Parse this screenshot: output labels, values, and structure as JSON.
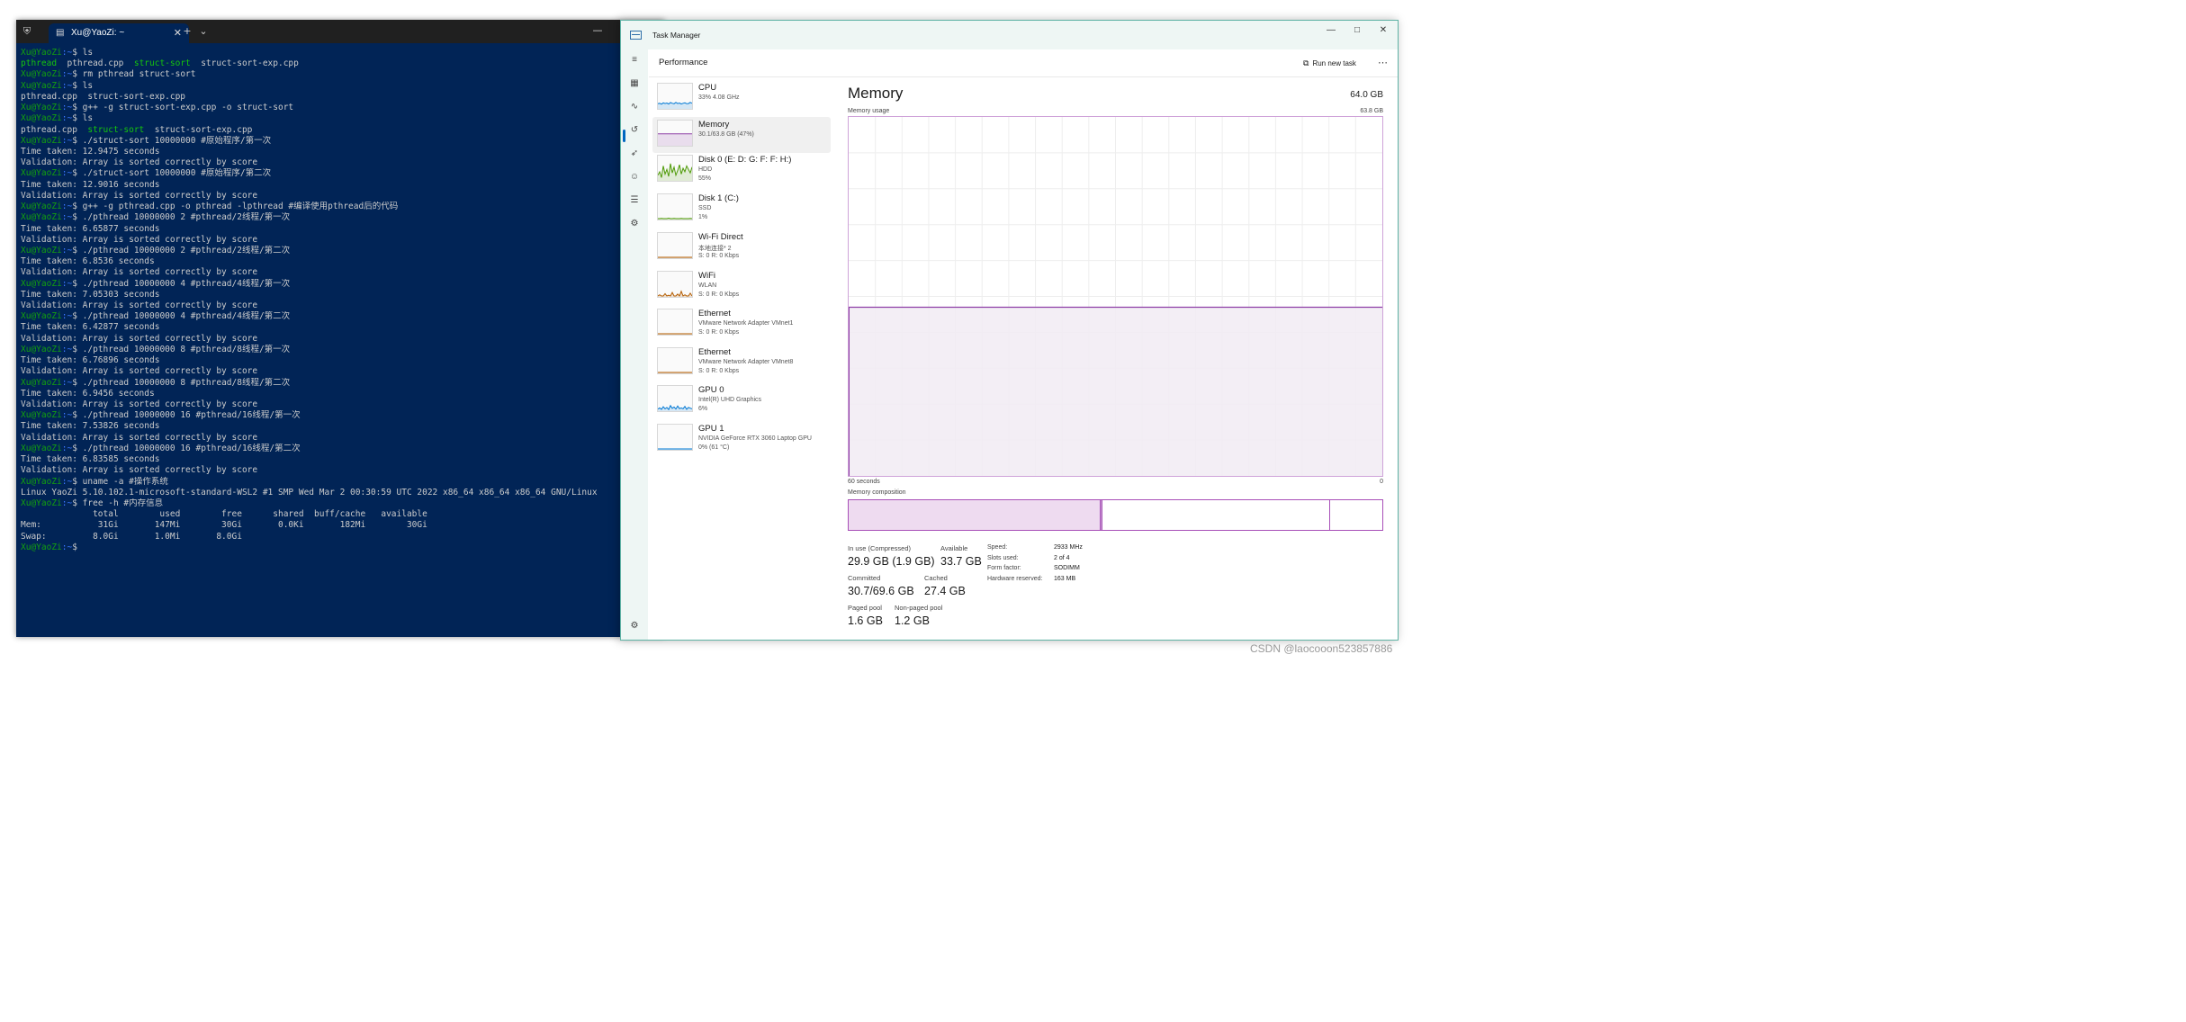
{
  "terminal": {
    "tab_title": "Xu@YaoZi: ~",
    "lines": [
      {
        "kind": "prompt",
        "user": "Xu@YaoZi",
        "path": ":~",
        "cmd": "$ ls"
      },
      {
        "kind": "files",
        "green": "pthread",
        "plain1": "  pthread.cpp  ",
        "green2": "struct-sort",
        "plain2": "  struct-sort-exp.cpp"
      },
      {
        "kind": "prompt",
        "user": "Xu@YaoZi",
        "path": ":~",
        "cmd": "$ rm pthread struct-sort"
      },
      {
        "kind": "prompt",
        "user": "Xu@YaoZi",
        "path": ":~",
        "cmd": "$ ls"
      },
      {
        "kind": "text",
        "text": "pthread.cpp  struct-sort-exp.cpp"
      },
      {
        "kind": "prompt",
        "user": "Xu@YaoZi",
        "path": ":~",
        "cmd": "$ g++ -g struct-sort-exp.cpp -o struct-sort"
      },
      {
        "kind": "prompt",
        "user": "Xu@YaoZi",
        "path": ":~",
        "cmd": "$ ls"
      },
      {
        "kind": "files",
        "green": "",
        "plain1": "pthread.cpp  ",
        "green2": "struct-sort",
        "plain2": "  struct-sort-exp.cpp"
      },
      {
        "kind": "prompt",
        "user": "Xu@YaoZi",
        "path": ":~",
        "cmd": "$ ./struct-sort 10000000 #原始程序/第一次"
      },
      {
        "kind": "text",
        "text": "Time taken: 12.9475 seconds"
      },
      {
        "kind": "text",
        "text": "Validation: Array is sorted correctly by score"
      },
      {
        "kind": "prompt",
        "user": "Xu@YaoZi",
        "path": ":~",
        "cmd": "$ ./struct-sort 10000000 #原始程序/第二次"
      },
      {
        "kind": "text",
        "text": "Time taken: 12.9016 seconds"
      },
      {
        "kind": "text",
        "text": "Validation: Array is sorted correctly by score"
      },
      {
        "kind": "prompt",
        "user": "Xu@YaoZi",
        "path": ":~",
        "cmd": "$ g++ -g pthread.cpp -o pthread -lpthread #编译使用pthread后的代码"
      },
      {
        "kind": "prompt",
        "user": "Xu@YaoZi",
        "path": ":~",
        "cmd": "$ ./pthread 10000000 2 #pthread/2线程/第一次"
      },
      {
        "kind": "text",
        "text": "Time taken: 6.65877 seconds"
      },
      {
        "kind": "text",
        "text": "Validation: Array is sorted correctly by score"
      },
      {
        "kind": "prompt",
        "user": "Xu@YaoZi",
        "path": ":~",
        "cmd": "$ ./pthread 10000000 2 #pthread/2线程/第二次"
      },
      {
        "kind": "text",
        "text": "Time taken: 6.8536 seconds"
      },
      {
        "kind": "text",
        "text": "Validation: Array is sorted correctly by score"
      },
      {
        "kind": "prompt",
        "user": "Xu@YaoZi",
        "path": ":~",
        "cmd": "$ ./pthread 10000000 4 #pthread/4线程/第一次"
      },
      {
        "kind": "text",
        "text": "Time taken: 7.05303 seconds"
      },
      {
        "kind": "text",
        "text": "Validation: Array is sorted correctly by score"
      },
      {
        "kind": "prompt",
        "user": "Xu@YaoZi",
        "path": ":~",
        "cmd": "$ ./pthread 10000000 4 #pthread/4线程/第二次"
      },
      {
        "kind": "text",
        "text": "Time taken: 6.42877 seconds"
      },
      {
        "kind": "text",
        "text": "Validation: Array is sorted correctly by score"
      },
      {
        "kind": "prompt",
        "user": "Xu@YaoZi",
        "path": ":~",
        "cmd": "$ ./pthread 10000000 8 #pthread/8线程/第一次"
      },
      {
        "kind": "text",
        "text": "Time taken: 6.76896 seconds"
      },
      {
        "kind": "text",
        "text": "Validation: Array is sorted correctly by score"
      },
      {
        "kind": "prompt",
        "user": "Xu@YaoZi",
        "path": ":~",
        "cmd": "$ ./pthread 10000000 8 #pthread/8线程/第二次"
      },
      {
        "kind": "text",
        "text": "Time taken: 6.9456 seconds"
      },
      {
        "kind": "text",
        "text": "Validation: Array is sorted correctly by score"
      },
      {
        "kind": "prompt",
        "user": "Xu@YaoZi",
        "path": ":~",
        "cmd": "$ ./pthread 10000000 16 #pthread/16线程/第一次"
      },
      {
        "kind": "text",
        "text": "Time taken: 7.53826 seconds"
      },
      {
        "kind": "text",
        "text": "Validation: Array is sorted correctly by score"
      },
      {
        "kind": "prompt",
        "user": "Xu@YaoZi",
        "path": ":~",
        "cmd": "$ ./pthread 10000000 16 #pthread/16线程/第二次"
      },
      {
        "kind": "text",
        "text": "Time taken: 6.83585 seconds"
      },
      {
        "kind": "text",
        "text": "Validation: Array is sorted correctly by score"
      },
      {
        "kind": "prompt",
        "user": "Xu@YaoZi",
        "path": ":~",
        "cmd": "$ uname -a #操作系统"
      },
      {
        "kind": "text",
        "text": "Linux YaoZi 5.10.102.1-microsoft-standard-WSL2 #1 SMP Wed Mar 2 00:30:59 UTC 2022 x86_64 x86_64 x86_64 GNU/Linux"
      },
      {
        "kind": "prompt",
        "user": "Xu@YaoZi",
        "path": ":~",
        "cmd": "$ free -h #内存信息"
      },
      {
        "kind": "text",
        "text": "              total        used        free      shared  buff/cache   available"
      },
      {
        "kind": "text",
        "text": "Mem:           31Gi       147Mi        30Gi       0.0Ki       182Mi        30Gi"
      },
      {
        "kind": "text",
        "text": "Swap:         8.0Gi       1.0Mi       8.0Gi"
      },
      {
        "kind": "prompt",
        "user": "Xu@YaoZi",
        "path": ":~",
        "cmd": "$"
      }
    ],
    "colors": {
      "background": "#012456",
      "prompt_user": "#13a10e",
      "prompt_path": "#3b78ff",
      "exec_file": "#16c60c"
    }
  },
  "task_manager": {
    "title": "Task Manager",
    "section": "Performance",
    "run_new_task": "Run new task",
    "resources": [
      {
        "name": "CPU",
        "lines": [
          "33%  4.08 GHz"
        ],
        "color": "#0078d4",
        "spark": [
          18,
          20,
          16,
          22,
          19,
          21,
          17,
          23,
          20,
          18,
          24,
          19,
          21,
          17,
          20,
          22,
          18,
          19,
          24,
          20
        ]
      },
      {
        "name": "Memory",
        "lines": [
          "30.1/63.8 GB (47%)"
        ],
        "color": "#8e3fa6",
        "spark": [
          47,
          47,
          47,
          47,
          47,
          47,
          47,
          47,
          47,
          47,
          47,
          47,
          47,
          47,
          47,
          47,
          47,
          47,
          47,
          47
        ],
        "selected": true
      },
      {
        "name": "Disk 0 (E: D: G: F: F: H:)",
        "lines": [
          "HDD",
          "55%"
        ],
        "color": "#4e9a06",
        "spark": [
          20,
          35,
          10,
          60,
          25,
          45,
          15,
          70,
          30,
          55,
          20,
          40,
          65,
          25,
          50,
          35,
          60,
          45,
          30,
          55
        ]
      },
      {
        "name": "Disk 1 (C:)",
        "lines": [
          "SSD",
          "1%"
        ],
        "color": "#4e9a06",
        "spark": [
          0,
          0,
          1,
          0,
          0,
          0,
          2,
          0,
          0,
          1,
          0,
          0,
          0,
          1,
          0,
          0,
          0,
          0,
          1,
          0
        ]
      },
      {
        "name": "Wi-Fi Direct",
        "lines": [
          "本地连接* 2",
          "S: 0 R: 0 Kbps"
        ],
        "color": "#b35c00",
        "spark": [
          0,
          0,
          0,
          0,
          0,
          0,
          0,
          0,
          0,
          0,
          0,
          0,
          0,
          0,
          0,
          0,
          0,
          0,
          0,
          0
        ]
      },
      {
        "name": "WiFi",
        "lines": [
          "WLAN",
          "S: 0 R: 0 Kbps"
        ],
        "color": "#b35c00",
        "spark": [
          0,
          5,
          0,
          0,
          10,
          0,
          3,
          0,
          15,
          0,
          0,
          8,
          0,
          20,
          0,
          5,
          0,
          0,
          12,
          0
        ]
      },
      {
        "name": "Ethernet",
        "lines": [
          "VMware Network Adapter VMnet1",
          "S: 0 R: 0 Kbps"
        ],
        "color": "#b35c00",
        "spark": [
          0,
          0,
          0,
          0,
          0,
          0,
          0,
          0,
          0,
          0,
          0,
          0,
          0,
          0,
          0,
          0,
          0,
          0,
          0,
          0
        ]
      },
      {
        "name": "Ethernet",
        "lines": [
          "VMware Network Adapter VMnet8",
          "S: 0 R: 0 Kbps"
        ],
        "color": "#b35c00",
        "spark": [
          0,
          0,
          0,
          0,
          0,
          0,
          0,
          0,
          0,
          0,
          0,
          0,
          0,
          0,
          0,
          0,
          0,
          0,
          0,
          0
        ]
      },
      {
        "name": "GPU 0",
        "lines": [
          "Intel(R) UHD Graphics",
          "6%"
        ],
        "color": "#0078d4",
        "spark": [
          5,
          10,
          4,
          15,
          6,
          12,
          3,
          20,
          8,
          14,
          5,
          18,
          7,
          10,
          6,
          16,
          4,
          12,
          9,
          6
        ]
      },
      {
        "name": "GPU 1",
        "lines": [
          "NVIDIA GeForce RTX 3060 Laptop GPU",
          "0% (61 °C)"
        ],
        "color": "#0078d4",
        "spark": [
          0,
          0,
          0,
          0,
          0,
          0,
          0,
          0,
          0,
          0,
          0,
          0,
          0,
          0,
          0,
          0,
          0,
          0,
          0,
          0
        ]
      }
    ],
    "memory": {
      "title": "Memory",
      "total": "64.0 GB",
      "usage_label": "Memory usage",
      "max_label": "63.8 GB",
      "time_label": "60 seconds",
      "zero_label": "0",
      "composition_label": "Memory composition",
      "usage_fraction": 0.47,
      "composition": {
        "in_use": 0.47,
        "modified": 0.004,
        "standby": 0.426,
        "free": 0.1
      },
      "stats": {
        "in_use_label": "In use (Compressed)",
        "in_use_value": "29.9 GB (1.9 GB)",
        "available_label": "Available",
        "available_value": "33.7 GB",
        "committed_label": "Committed",
        "committed_value": "30.7/69.6 GB",
        "cached_label": "Cached",
        "cached_value": "27.4 GB",
        "paged_label": "Paged pool",
        "paged_value": "1.6 GB",
        "nonpaged_label": "Non-paged pool",
        "nonpaged_value": "1.2 GB"
      },
      "details": [
        {
          "key": "Speed:",
          "value": "2933 MHz"
        },
        {
          "key": "Slots used:",
          "value": "2 of 4"
        },
        {
          "key": "Form factor:",
          "value": "SODIMM"
        },
        {
          "key": "Hardware reserved:",
          "value": "163 MB"
        }
      ],
      "colors": {
        "line": "#8e3fa6",
        "fill": "#f1ebf3",
        "composition_in_use": "#eedbf0",
        "grid": "#eeeeee"
      }
    },
    "nav_icons": [
      "hamburger-icon",
      "processes-icon",
      "performance-icon",
      "app-history-icon",
      "startup-apps-icon",
      "users-icon",
      "details-icon",
      "services-icon",
      "settings-icon"
    ]
  },
  "watermark": "CSDN @laocooon523857886"
}
